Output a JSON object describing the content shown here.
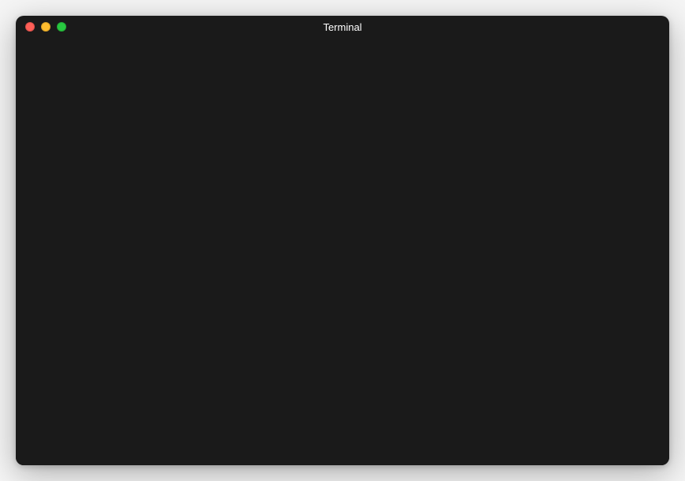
{
  "window": {
    "title": "Terminal"
  },
  "terminal": {
    "content": ""
  }
}
